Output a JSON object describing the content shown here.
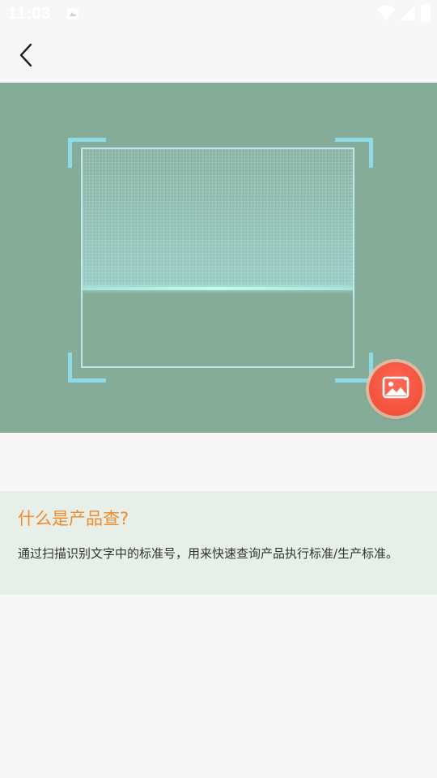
{
  "status_bar": {
    "time": "11:03"
  },
  "top_bar": {
    "back_icon": "back-chevron-icon"
  },
  "scanner": {
    "gallery_icon": "image-gallery-icon",
    "colors": {
      "camera_background": "#85ac98",
      "frame": "#bfe8ea",
      "corners": "#8edbe6",
      "gallery_button": "#f4553f"
    }
  },
  "info": {
    "title": "什么是产品查?",
    "description": "通过扫描识别文字中的标准号，用来快速查询产品执行标准/生产标准。",
    "colors": {
      "title": "#f08a2c",
      "card_background": "#e6efe8"
    }
  }
}
